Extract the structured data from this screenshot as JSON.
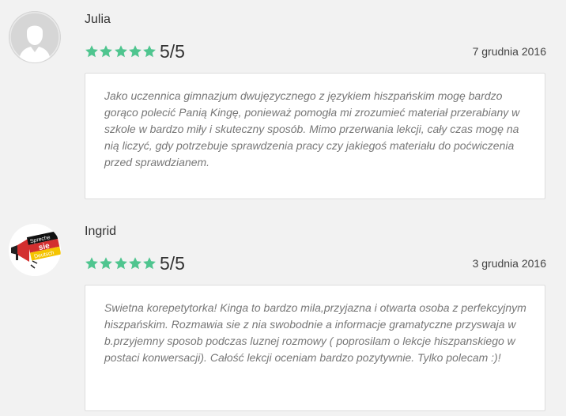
{
  "reviews": [
    {
      "name": "Julia",
      "rating_label": "5/5",
      "stars": 5,
      "date": "7 grudnia 2016",
      "text": "Jako uczennica gimnazjum dwujęzycznego z językiem hiszpańskim mogę bardzo gorąco polecić Panią Kingę, ponieważ pomogła mi zrozumieć materiał przerabiany w szkole w bardzo miły i skuteczny sposób. Mimo przerwania lekcji, cały czas mogę na nią liczyć, gdy potrzebuje sprawdzenia pracy czy jakiegoś materiału do poćwiczenia przed sprawdzianem.",
      "avatar": "default-user-icon"
    },
    {
      "name": "Ingrid",
      "rating_label": "5/5",
      "stars": 5,
      "date": "3 grudnia 2016",
      "text": "Swietna korepetytorka! Kinga to bardzo mila,przyjazna i otwarta osoba z perfekcyjnym hiszpańskim. Rozmawia sie z nia swobodnie a informacje gramatyczne przyswaja w b.przyjemny sposob podczas luznej rozmowy ( poprosilam o lekcje hiszpanskiego w postaci konwersacji). Całość lekcji oceniam bardzo pozytywnie. Tylko polecam :)!",
      "avatar": "megaphone-logo",
      "avatar_logo_text": [
        "Spreche",
        "sie",
        "Deutsch"
      ]
    }
  ],
  "colors": {
    "star": "#4fc58f",
    "background": "#f2f2f2",
    "box_border": "#dddddd",
    "comment_text": "#777777"
  }
}
